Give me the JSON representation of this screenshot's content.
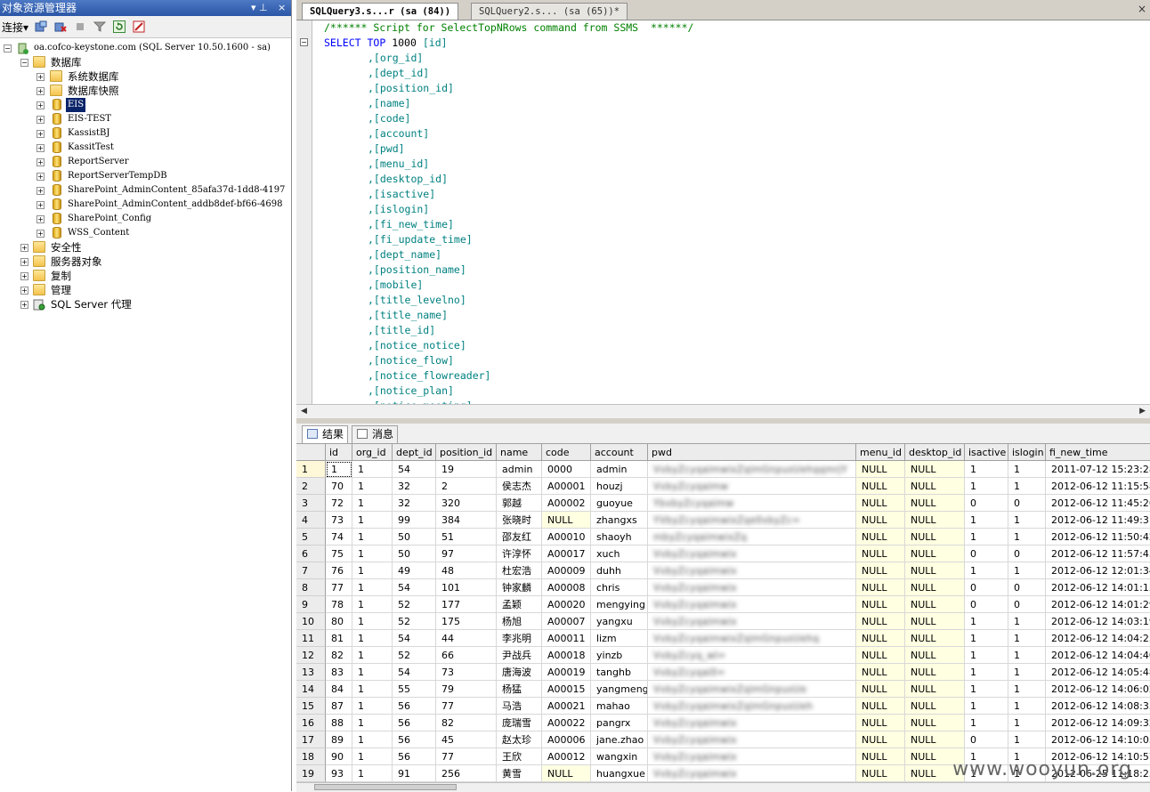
{
  "explorer": {
    "title": "对象资源管理器",
    "pin_glyph": "▾ ⊥",
    "close_glyph": "×",
    "connect_label": "连接",
    "connect_arrow": "▾",
    "tree": {
      "server": "oa.cofco-keystone.com (SQL Server 10.50.1600 - sa)",
      "databases_folder": "数据库",
      "items": [
        {
          "label": "系统数据库",
          "type": "folder"
        },
        {
          "label": "数据库快照",
          "type": "folder"
        },
        {
          "label": "EIS",
          "type": "db",
          "selected": true
        },
        {
          "label": "EIS-TEST",
          "type": "db"
        },
        {
          "label": "KassistBJ",
          "type": "db"
        },
        {
          "label": "KassitTest",
          "type": "db"
        },
        {
          "label": "ReportServer",
          "type": "db"
        },
        {
          "label": "ReportServerTempDB",
          "type": "db"
        },
        {
          "label": "SharePoint_AdminContent_85afa37d-1dd8-4197",
          "type": "db"
        },
        {
          "label": "SharePoint_AdminContent_addb8def-bf66-4698",
          "type": "db"
        },
        {
          "label": "SharePoint_Config",
          "type": "db"
        },
        {
          "label": "WSS_Content",
          "type": "db"
        }
      ],
      "top_level": [
        {
          "label": "安全性",
          "type": "folder"
        },
        {
          "label": "服务器对象",
          "type": "folder"
        },
        {
          "label": "复制",
          "type": "folder"
        },
        {
          "label": "管理",
          "type": "folder"
        },
        {
          "label": "SQL Server 代理",
          "type": "agent"
        }
      ]
    }
  },
  "tabs": [
    {
      "label": "SQLQuery3.s...r (sa (84))",
      "active": true
    },
    {
      "label": "SQLQuery2.s... (sa (65))*",
      "active": false
    }
  ],
  "tab_close": "×",
  "editor": {
    "comment": "/****** Script for SelectTopNRows command from SSMS  ******/",
    "select_kw": "SELECT",
    "top_kw": "TOP",
    "top_n": "1000",
    "first_col": "[id]",
    "columns": [
      ",[org_id]",
      ",[dept_id]",
      ",[position_id]",
      ",[name]",
      ",[code]",
      ",[account]",
      ",[pwd]",
      ",[menu_id]",
      ",[desktop_id]",
      ",[isactive]",
      ",[islogin]",
      ",[fi_new_time]",
      ",[fi_update_time]",
      ",[dept_name]",
      ",[position_name]",
      ",[mobile]",
      ",[title_levelno]",
      ",[title_name]",
      ",[title_id]",
      ",[notice_notice]",
      ",[notice_flow]",
      ",[notice_flowreader]",
      ",[notice_plan]",
      ",[notice_meeting]"
    ]
  },
  "results": {
    "tab_results": "结果",
    "tab_messages": "消息",
    "headers": [
      "id",
      "org_id",
      "dept_id",
      "position_id",
      "name",
      "code",
      "account",
      "pwd",
      "menu_id",
      "desktop_id",
      "isactive",
      "islogin",
      "fi_new_time"
    ],
    "rows": [
      [
        "1",
        "1",
        "54",
        "19",
        "admin",
        "0000",
        "admin",
        "VvbyZcyqaimwixZqimGnpusUehqqmrjY",
        "NULL",
        "NULL",
        "1",
        "1",
        "2011-07-12 15:23:28.0"
      ],
      [
        "70",
        "1",
        "32",
        "2",
        "侯志杰",
        "A00001",
        "houzj",
        "VvbyZcyqaimw",
        "NULL",
        "NULL",
        "1",
        "1",
        "2012-06-12 11:15:58.0"
      ],
      [
        "72",
        "1",
        "32",
        "320",
        "郭越",
        "A00002",
        "guoyue",
        "YbvbyZcyqaimw",
        "NULL",
        "NULL",
        "0",
        "0",
        "2012-06-12 11:45:26.0"
      ],
      [
        "73",
        "1",
        "99",
        "384",
        "张晓时",
        "NULL",
        "zhangxs",
        "YVbyZcyqaimwixZqe0vbyZc=",
        "NULL",
        "NULL",
        "1",
        "1",
        "2012-06-12 11:49:31.0"
      ],
      [
        "74",
        "1",
        "50",
        "51",
        "邵友红",
        "A00010",
        "shaoyh",
        "mbyZcyqaimwixZq",
        "NULL",
        "NULL",
        "1",
        "1",
        "2012-06-12 11:50:42.0"
      ],
      [
        "75",
        "1",
        "50",
        "97",
        "许淳怀",
        "A00017",
        "xuch",
        "VvbyZcyqaimwix",
        "NULL",
        "NULL",
        "0",
        "0",
        "2012-06-12 11:57:45.0"
      ],
      [
        "76",
        "1",
        "49",
        "48",
        "杜宏浩",
        "A00009",
        "duhh",
        "VvbyZcyqaimwix",
        "NULL",
        "NULL",
        "1",
        "1",
        "2012-06-12 12:01:34.0"
      ],
      [
        "77",
        "1",
        "54",
        "101",
        "钟家麟",
        "A00008",
        "chris",
        "VvbyZcyqaimwix",
        "NULL",
        "NULL",
        "0",
        "0",
        "2012-06-12 14:01:13.0"
      ],
      [
        "78",
        "1",
        "52",
        "177",
        "孟颖",
        "A00020",
        "mengying",
        "VvbyZcyqaimwix",
        "NULL",
        "NULL",
        "0",
        "0",
        "2012-06-12 14:01:29.0"
      ],
      [
        "80",
        "1",
        "52",
        "175",
        "杨旭",
        "A00007",
        "yangxu",
        "VvbyZcyqaimwix",
        "NULL",
        "NULL",
        "1",
        "1",
        "2012-06-12 14:03:19.0"
      ],
      [
        "81",
        "1",
        "54",
        "44",
        "李兆明",
        "A00011",
        "lizm",
        "VvbyZcyqaimwixZqimGnpusUehq",
        "NULL",
        "NULL",
        "1",
        "1",
        "2012-06-12 14:04:25.0"
      ],
      [
        "82",
        "1",
        "52",
        "66",
        "尹战兵",
        "A00018",
        "yinzb",
        "VvbyZcyq_wl=",
        "NULL",
        "NULL",
        "1",
        "1",
        "2012-06-12 14:04:40.0"
      ],
      [
        "83",
        "1",
        "54",
        "73",
        "唐海波",
        "A00019",
        "tanghb",
        "VvbyZcyqai0=",
        "NULL",
        "NULL",
        "1",
        "1",
        "2012-06-12 14:05:48.0"
      ],
      [
        "84",
        "1",
        "55",
        "79",
        "杨猛",
        "A00015",
        "yangmeng",
        "VvbyZcyqaimwixZqimGnpusUe",
        "NULL",
        "NULL",
        "1",
        "1",
        "2012-06-12 14:06:02.0"
      ],
      [
        "87",
        "1",
        "56",
        "77",
        "马浩",
        "A00021",
        "mahao",
        "VvbyZcyqaimwixZqimGnpusUeh",
        "NULL",
        "NULL",
        "1",
        "1",
        "2012-06-12 14:08:33.0"
      ],
      [
        "88",
        "1",
        "56",
        "82",
        "庞瑞雪",
        "A00022",
        "pangrx",
        "VvbyZcyqaimwix",
        "NULL",
        "NULL",
        "1",
        "1",
        "2012-06-12 14:09:32.0"
      ],
      [
        "89",
        "1",
        "56",
        "45",
        "赵太珍",
        "A00006",
        "jane.zhao",
        "VvbyZcyqaimwix",
        "NULL",
        "NULL",
        "0",
        "1",
        "2012-06-12 14:10:05.0"
      ],
      [
        "90",
        "1",
        "56",
        "77",
        "王欣",
        "A00012",
        "wangxin",
        "VvbyZcyqaimwix",
        "NULL",
        "NULL",
        "1",
        "1",
        "2012-06-12 14:10:57.0"
      ],
      [
        "93",
        "1",
        "91",
        "256",
        "黄雪",
        "NULL",
        "huangxue",
        "VvbyZcyqaimwix",
        "NULL",
        "NULL",
        "1",
        "1",
        "2012-06-25 11:18:25.0"
      ]
    ]
  },
  "watermark": "www.wooyun.org"
}
